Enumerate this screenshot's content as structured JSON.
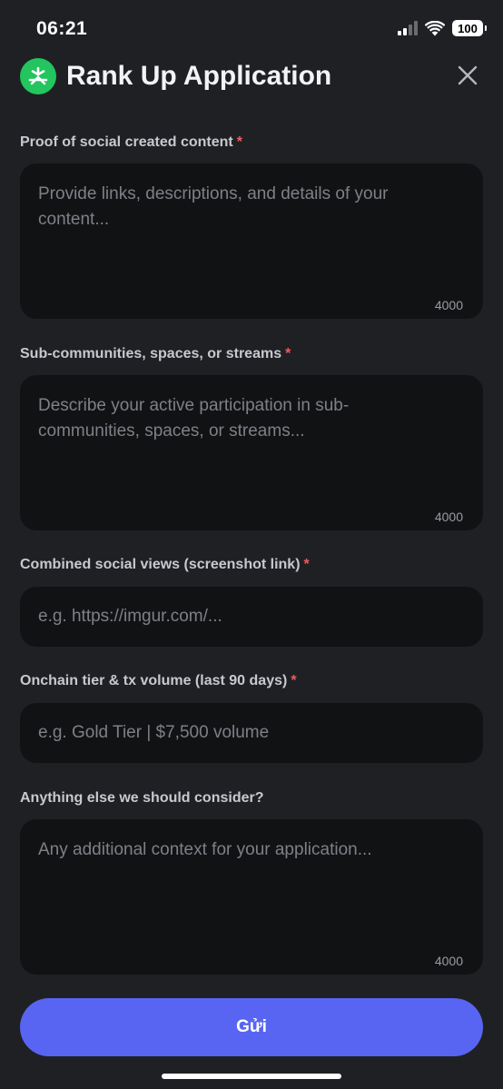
{
  "status_bar": {
    "time": "06:21",
    "battery": "100",
    "icons": [
      "signal-icon",
      "wifi-icon",
      "battery-icon"
    ]
  },
  "header": {
    "title": "Rank Up Application",
    "logo_icon": "app-logo-icon",
    "close_icon": "close-icon",
    "logo_color": "#23c55e"
  },
  "form": {
    "fields": [
      {
        "label": "Proof of social created content",
        "required_mark": "*",
        "placeholder": "Provide links, descriptions, and details of your content...",
        "value": "",
        "counter": "4000"
      },
      {
        "label": "Sub-communities, spaces, or streams",
        "required_mark": "*",
        "placeholder": "Describe your active participation in sub-communities, spaces, or streams...",
        "value": "",
        "counter": "4000"
      },
      {
        "label": "Combined social views (screenshot link)",
        "required_mark": "*",
        "placeholder": "e.g. https://imgur.com/...",
        "value": ""
      },
      {
        "label": "Onchain tier & tx volume (last 90 days)",
        "required_mark": "*",
        "placeholder": "e.g. Gold Tier | $7,500 volume",
        "value": ""
      },
      {
        "label": "Anything else we should consider?",
        "placeholder": "Any additional context for your application...",
        "value": "",
        "counter": "4000"
      }
    ],
    "submit_label": "Gửi"
  },
  "colors": {
    "background": "#1f2024",
    "field_background": "#111214",
    "accent": "#5865f2",
    "required": "#f25b5b"
  }
}
